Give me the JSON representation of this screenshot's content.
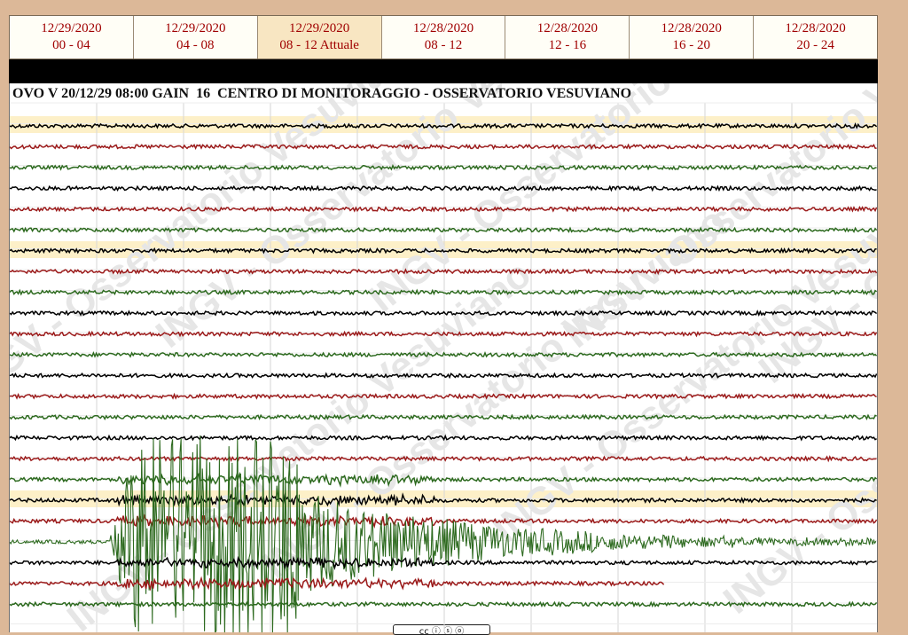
{
  "tabs": [
    {
      "date": "12/29/2020",
      "range": "00 - 04",
      "active": false
    },
    {
      "date": "12/29/2020",
      "range": "04 - 08",
      "active": false
    },
    {
      "date": "12/29/2020",
      "range": "08 - 12 Attuale",
      "active": true
    },
    {
      "date": "12/28/2020",
      "range": "08 - 12",
      "active": false
    },
    {
      "date": "12/28/2020",
      "range": "12 - 16",
      "active": false
    },
    {
      "date": "12/28/2020",
      "range": "16 - 20",
      "active": false
    },
    {
      "date": "12/28/2020",
      "range": "20 - 24",
      "active": false
    }
  ],
  "seismogram": {
    "header": "OVO V 20/12/29 08:00 GAIN  16  CENTRO DI MONITORAGGIO - OSSERVATORIO VESUVIANO",
    "watermark": "INGV - Osservatorio Vesuviano",
    "trace_colors": [
      "#000000",
      "#9b1a1a",
      "#2d6a1f"
    ],
    "highlight_color": "#fdf0c8",
    "grid_color": "#d6d6d6"
  },
  "footer": {
    "license_badge": "cc ⓘ ⓢ ⓞ"
  }
}
